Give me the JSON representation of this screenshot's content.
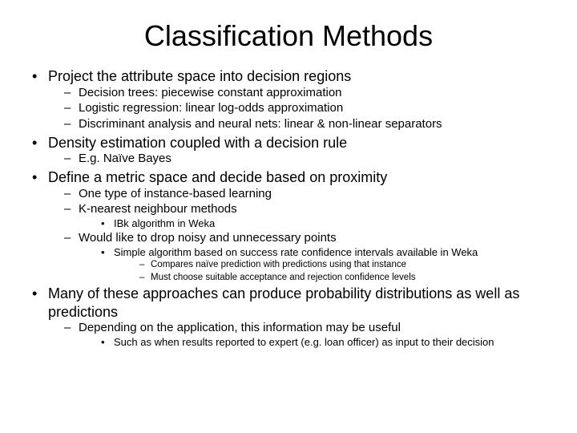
{
  "title": "Classification Methods",
  "b1": {
    "text": "Project the attribute space into decision regions",
    "sub": [
      "Decision trees: piecewise constant approximation",
      "Logistic regression: linear log-odds approximation",
      "Discriminant analysis and neural nets: linear & non-linear separators"
    ]
  },
  "b2": {
    "text": "Density estimation coupled with a decision rule",
    "sub": [
      "E.g. Naïve Bayes"
    ]
  },
  "b3": {
    "text": "Define a metric space and decide based on proximity",
    "sub1": "One type of instance-based learning",
    "sub2": "K-nearest neighbour methods",
    "sub2a": "IBk algorithm in Weka",
    "sub3": "Would like to drop noisy and unnecessary points",
    "sub3a": "Simple algorithm based on success rate confidence intervals available in Weka",
    "sub3a_i": "Compares naïve prediction with predictions using that instance",
    "sub3a_ii": "Must choose suitable acceptance and rejection confidence levels"
  },
  "b4": {
    "text": "Many of these approaches can produce probability distributions as well as predictions",
    "sub1": "Depending on the application, this information may be useful",
    "sub1a": "Such as when results reported to expert (e.g. loan officer) as input to their decision"
  }
}
